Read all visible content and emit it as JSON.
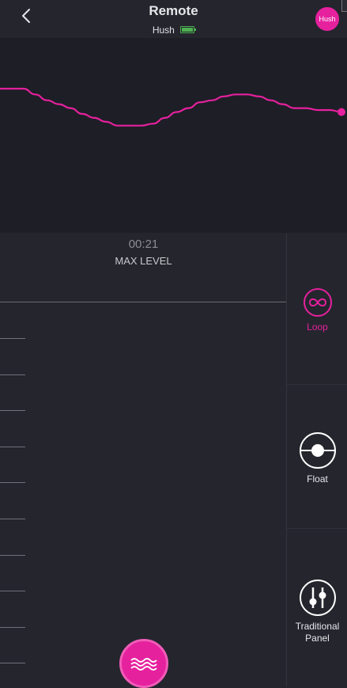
{
  "header": {
    "title": "Remote",
    "device_name": "Hush",
    "avatar_text": "Hush",
    "back_icon": "chevron-left-icon",
    "battery_level": 1.0
  },
  "timer": "00:21",
  "level_label": "MAX LEVEL",
  "pattern": {
    "color": "#e6219e",
    "values": [
      0.74,
      0.74,
      0.74,
      0.71,
      0.68,
      0.66,
      0.64,
      0.61,
      0.59,
      0.57,
      0.55,
      0.55,
      0.55,
      0.56,
      0.59,
      0.62,
      0.64,
      0.67,
      0.68,
      0.7,
      0.71,
      0.71,
      0.7,
      0.68,
      0.66,
      0.64,
      0.64,
      0.63,
      0.63,
      0.62
    ]
  },
  "side_panel": {
    "items": [
      {
        "label": "Loop",
        "icon": "infinity-icon",
        "active": true
      },
      {
        "label": "Float",
        "icon": "float-icon",
        "active": false
      },
      {
        "label": "Traditional Panel",
        "icon": "sliders-icon",
        "active": false
      }
    ]
  },
  "wave_button": {
    "icon": "wave-icon"
  },
  "colors": {
    "accent": "#e6219e",
    "background": "#25252e",
    "graph_background": "#1e1e26",
    "battery": "#4caf50"
  }
}
